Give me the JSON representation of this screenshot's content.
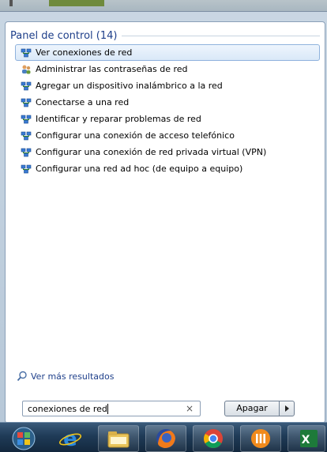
{
  "panel": {
    "title": "Panel de control (14)"
  },
  "results": [
    {
      "label": "Ver conexiones de red",
      "icon": "network-icon",
      "selected": true
    },
    {
      "label": "Administrar las contraseñas de red",
      "icon": "users-icon",
      "selected": false
    },
    {
      "label": "Agregar un dispositivo inalámbrico a la red",
      "icon": "network-icon",
      "selected": false
    },
    {
      "label": "Conectarse a una red",
      "icon": "network-icon",
      "selected": false
    },
    {
      "label": "Identificar y reparar problemas de red",
      "icon": "network-icon",
      "selected": false
    },
    {
      "label": "Configurar una conexión de acceso telefónico",
      "icon": "network-icon",
      "selected": false
    },
    {
      "label": "Configurar una conexión de red privada virtual (VPN)",
      "icon": "network-icon",
      "selected": false
    },
    {
      "label": "Configurar una red ad hoc (de equipo a equipo)",
      "icon": "network-icon",
      "selected": false
    }
  ],
  "more_results": "Ver más resultados",
  "search": {
    "value": "conexiones de red",
    "clear_glyph": "×"
  },
  "power": {
    "label": "Apagar"
  },
  "taskbar": {
    "items": [
      "start-orb-icon",
      "internet-explorer-icon",
      "file-explorer-icon",
      "firefox-icon",
      "chrome-icon",
      "app-icon",
      "excel-icon"
    ]
  },
  "colors": {
    "accent": "#1e3f8a",
    "selection": "#d9e8f8"
  }
}
